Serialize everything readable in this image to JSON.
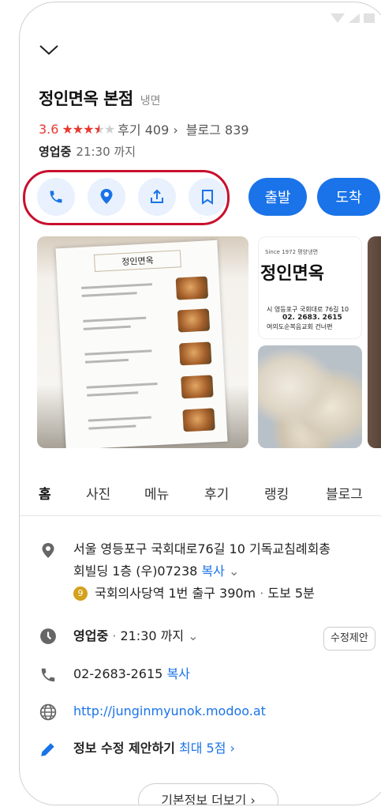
{
  "place": {
    "name": "정인면옥 본점",
    "category": "냉면",
    "rating": "3.6",
    "review_label": "후기",
    "review_count": "409",
    "blog_label": "블로그",
    "blog_count": "839",
    "status": "영업중",
    "close_time": "21:30 까지"
  },
  "actions": {
    "call_icon": "phone-icon",
    "save_icon": "location-pin-icon",
    "share_icon": "share-icon",
    "bookmark_icon": "bookmark-icon",
    "depart_label": "출발",
    "arrive_label": "도착",
    "accent_color": "#1a73e8"
  },
  "photos": {
    "menu_header": "정인면옥",
    "sign_top": "Since 1972 평양냉면",
    "sign_name": "정인면옥",
    "sign_address_1": "시 영등포구 국회대로 76길 10",
    "sign_phone": "02. 2683. 2615",
    "sign_address_2": "여의도순복음교회 건너편"
  },
  "tabs": [
    "홈",
    "사진",
    "메뉴",
    "후기",
    "랭킹",
    "블로그"
  ],
  "info": {
    "address_line1": "서울 영등포구 국회대로76길 10 기독교침례회총",
    "address_line2": "회빌딩 1층 (우)07238",
    "copy_label": "복사",
    "subway_line": "9",
    "subway_text": "국회의사당역 1번 출구 390m",
    "walk_text": "도보 5분",
    "status": "영업중",
    "hours": "21:30 까지",
    "suggest_label": "수정제안",
    "phone": "02-2683-2615",
    "website": "http://junginmyunok.modoo.at",
    "edit_label": "정보 수정 제안하기",
    "edit_reward": "최대 5점",
    "more_label": "기본정보 더보기"
  }
}
